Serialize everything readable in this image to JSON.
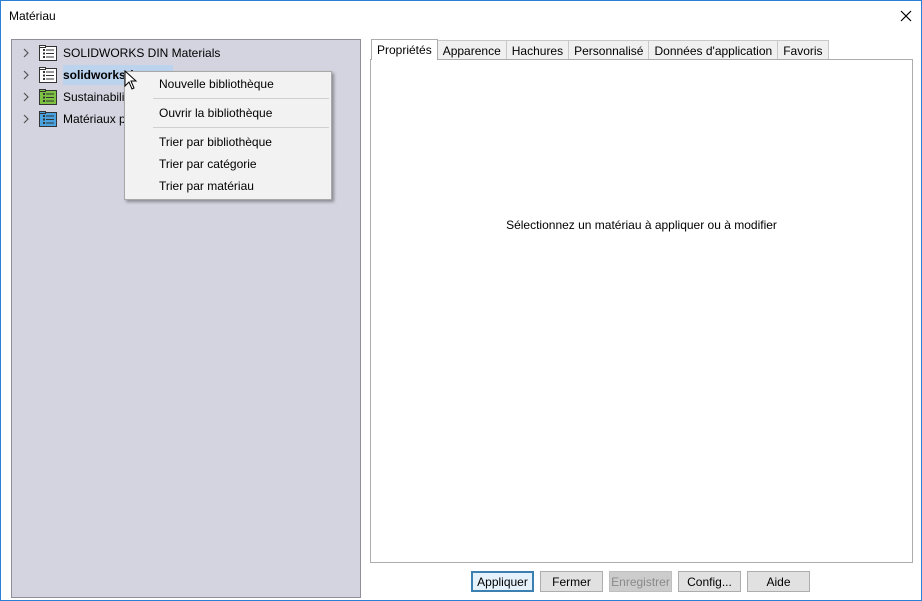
{
  "window": {
    "title": "Matériau"
  },
  "tree": {
    "items": [
      {
        "label": "SOLIDWORKS DIN Materials",
        "icon": "library-icon",
        "icon_color": "#ffffff",
        "selected": false
      },
      {
        "label": "solidworks (",
        "icon": "library-icon",
        "icon_color": "#ffffff",
        "selected": true
      },
      {
        "label": "Sustainabili",
        "icon": "library-icon",
        "icon_color": "#7dc242",
        "selected": false
      },
      {
        "label": "Matériaux p",
        "icon": "library-icon",
        "icon_color": "#4aa3df",
        "selected": false
      }
    ]
  },
  "context_menu": {
    "items": [
      {
        "label": "Nouvelle bibliothèque"
      },
      {
        "label": "Ouvrir la bibliothèque"
      },
      {
        "label": "Trier par bibliothèque"
      },
      {
        "label": "Trier par catégorie"
      },
      {
        "label": "Trier par matériau"
      }
    ]
  },
  "tabs": [
    {
      "label": "Propriétés",
      "active": true
    },
    {
      "label": "Apparence",
      "active": false
    },
    {
      "label": "Hachures",
      "active": false
    },
    {
      "label": "Personnalisé",
      "active": false
    },
    {
      "label": "Données d'application",
      "active": false
    },
    {
      "label": "Favoris",
      "active": false
    }
  ],
  "content": {
    "message": "Sélectionnez un matériau à appliquer ou à modifier"
  },
  "buttons": {
    "apply": "Appliquer",
    "close": "Fermer",
    "save": "Enregistrer",
    "config": "Config...",
    "help": "Aide"
  },
  "colors": {
    "tree_background": "#d4d4e0",
    "selection": "#bcd3ee",
    "accent": "#3c7fb1"
  }
}
